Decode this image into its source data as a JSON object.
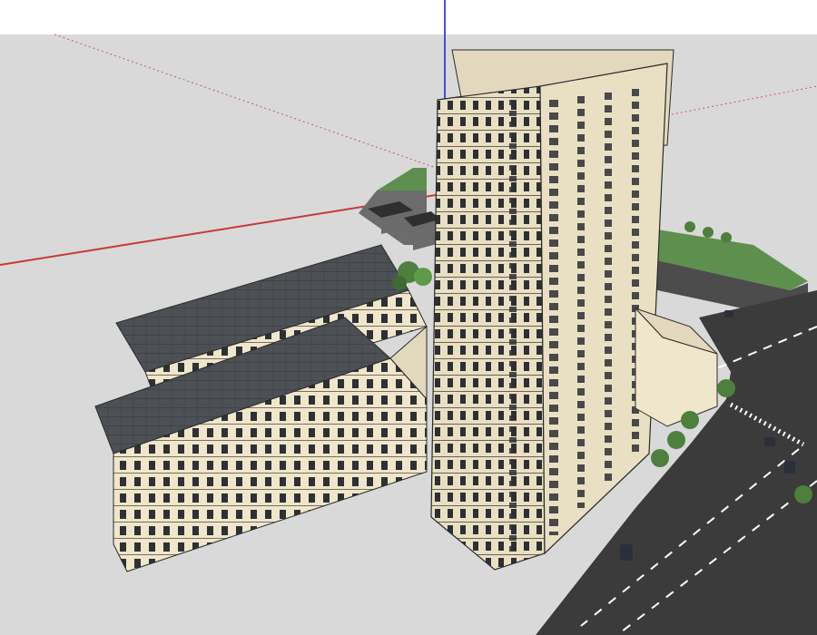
{
  "window": {
    "title": ""
  },
  "viewport": {
    "label": "",
    "background": "#dcdcdc",
    "sky": "#ffffff",
    "ground": "#d9d9d9"
  },
  "axes": {
    "blue": "#3f51c9",
    "red": "#c53a3a",
    "green": "#4f9b4f"
  },
  "model": {
    "tower": {
      "name": "",
      "facade_color": "#e9e0c4",
      "line_color": "#3a3a3a"
    },
    "lowrise": {
      "name": "",
      "roof_color": "#4d5156",
      "facade_color": "#efe6cc"
    },
    "pavilion": {
      "name": "",
      "color": "#e3d8bd"
    },
    "road": {
      "color": "#3b3b3b",
      "marking": "#ffffff"
    },
    "lawn": {
      "color": "#5f8f4f"
    },
    "trees": {
      "color": "#4e7f3d"
    }
  }
}
